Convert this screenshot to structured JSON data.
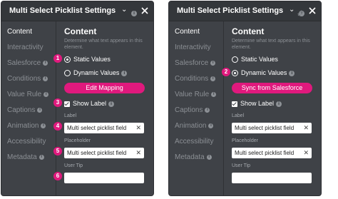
{
  "header": {
    "title": "Multi Select Picklist Settings"
  },
  "sidebar": {
    "items": [
      {
        "label": "Content"
      },
      {
        "label": "Interactivity"
      },
      {
        "label": "Salesforce"
      },
      {
        "label": "Conditions"
      },
      {
        "label": "Value Rule"
      },
      {
        "label": "Captions"
      },
      {
        "label": "Animation"
      },
      {
        "label": "Accessibility"
      },
      {
        "label": "Metadata"
      }
    ]
  },
  "content": {
    "title": "Content",
    "description": "Determine what text appears in this element.",
    "static_values": "Static Values",
    "dynamic_values": "Dynamic Values",
    "show_label": "Show Label",
    "label_caption": "Label",
    "label_value": "Multi select picklist field",
    "placeholder_caption": "Placeholder",
    "placeholder_value": "Multi select picklist field",
    "user_tip_caption": "User Tip",
    "user_tip_value": ""
  },
  "panel_left": {
    "button_label": "Edit Mapping",
    "selected_source": "Static Values",
    "steps": [
      "1",
      "3",
      "4",
      "5",
      "6"
    ]
  },
  "panel_right": {
    "button_label": "Sync from Salesforce",
    "selected_source": "Dynamic Values",
    "steps": [
      "2"
    ]
  },
  "colors": {
    "panel_bg": "#3f4247",
    "accent": "#e0197d",
    "muted_text": "#8b8f94"
  }
}
